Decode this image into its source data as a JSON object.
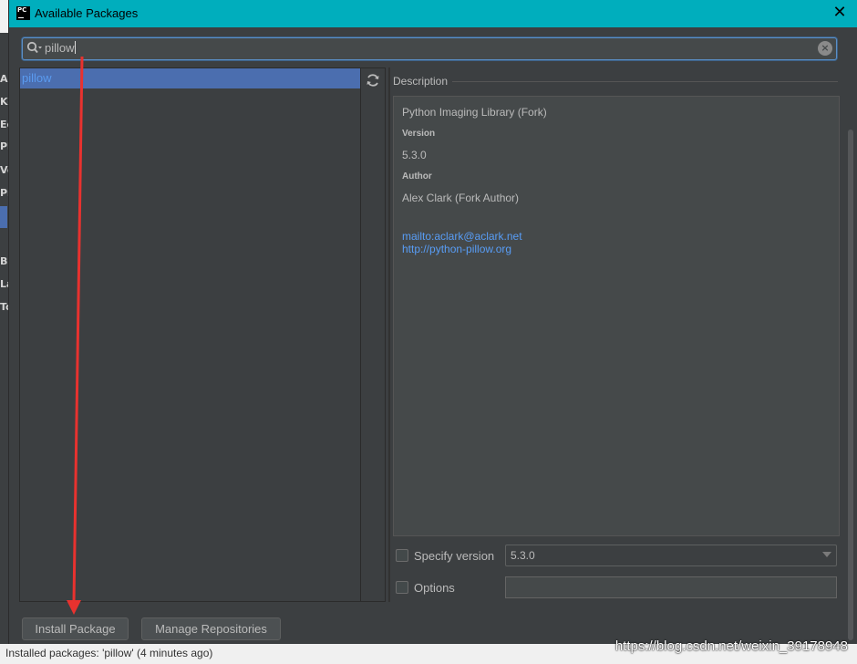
{
  "dialog": {
    "title": "Available Packages",
    "logo_text": "PC",
    "close_glyph": "✕"
  },
  "background_ide": {
    "fragments": [
      "Ap",
      "Ke",
      "Ec",
      "Pl",
      "Ve",
      "Pr",
      "Bu",
      "La",
      "To"
    ]
  },
  "search": {
    "value": "pillow"
  },
  "packages": {
    "items": [
      "pillow"
    ],
    "selected": "pillow"
  },
  "description": {
    "label": "Description",
    "summary": "Python Imaging Library (Fork)",
    "version_heading": "Version",
    "version_value": "5.3.0",
    "author_heading": "Author",
    "author_value": "Alex Clark (Fork Author)",
    "links": [
      "mailto:aclark@aclark.net",
      "http://python-pillow.org"
    ]
  },
  "options": {
    "specify_version_label": "Specify version",
    "specify_version_checked": false,
    "version_selected": "5.3.0",
    "options_label": "Options",
    "options_checked": false,
    "options_value": ""
  },
  "buttons": {
    "install_label": "Install Package",
    "manage_label": "Manage Repositories"
  },
  "status_bar": {
    "text": "Installed packages: 'pillow' (4 minutes ago)"
  },
  "watermark": "https://blog.csdn.net/weixin_39178948",
  "colors": {
    "titlebar": "#00aebd",
    "selection": "#4b6eaf",
    "link": "#589df6",
    "annotation_arrow": "#e8322f"
  }
}
